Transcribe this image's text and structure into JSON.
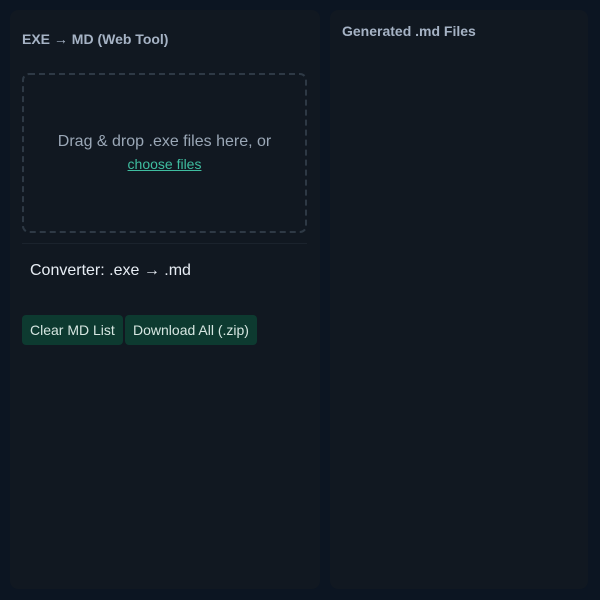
{
  "left_panel": {
    "title": "EXE → MD (Web Tool)",
    "dropzone": {
      "text": "Drag & drop .exe files here, or",
      "link_label": "choose files"
    },
    "converter_label": "Converter: .exe → .md",
    "buttons": {
      "clear_label": "Clear MD List",
      "download_label": "Download All (.zip)"
    }
  },
  "right_panel": {
    "title": "Generated .md Files",
    "files": []
  },
  "colors": {
    "background": "#0c1522",
    "panel": "#111821",
    "accent": "#3fbda0",
    "button_bg": "#0d3a30"
  }
}
